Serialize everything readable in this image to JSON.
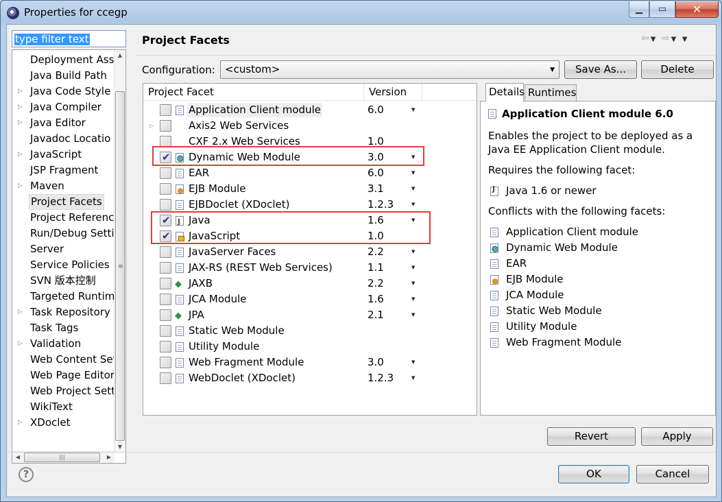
{
  "window": {
    "title": "Properties for ccegp"
  },
  "filter": {
    "value": "type filter text"
  },
  "tree": {
    "items": [
      {
        "label": "Deployment Asse",
        "expandable": false
      },
      {
        "label": "Java Build Path",
        "expandable": false
      },
      {
        "label": "Java Code Style",
        "expandable": true
      },
      {
        "label": "Java Compiler",
        "expandable": true
      },
      {
        "label": "Java Editor",
        "expandable": true
      },
      {
        "label": "Javadoc Locatio",
        "expandable": false
      },
      {
        "label": "JavaScript",
        "expandable": true
      },
      {
        "label": "JSP Fragment",
        "expandable": false
      },
      {
        "label": "Maven",
        "expandable": true
      },
      {
        "label": "Project Facets",
        "expandable": false,
        "selected": true
      },
      {
        "label": "Project Referenc",
        "expandable": false
      },
      {
        "label": "Run/Debug Setti",
        "expandable": false
      },
      {
        "label": "Server",
        "expandable": false
      },
      {
        "label": "Service Policies",
        "expandable": false
      },
      {
        "label": "SVN 版本控制",
        "expandable": false
      },
      {
        "label": "Targeted Runtim",
        "expandable": false
      },
      {
        "label": "Task Repository",
        "expandable": true
      },
      {
        "label": "Task Tags",
        "expandable": false
      },
      {
        "label": "Validation",
        "expandable": true
      },
      {
        "label": "Web Content Set",
        "expandable": false
      },
      {
        "label": "Web Page Editor",
        "expandable": false
      },
      {
        "label": "Web Project Sett",
        "expandable": false
      },
      {
        "label": "WikiText",
        "expandable": false
      },
      {
        "label": "XDoclet",
        "expandable": true
      }
    ]
  },
  "page": {
    "title": "Project Facets"
  },
  "configuration": {
    "label": "Configuration:",
    "value": "<custom>",
    "save_as": "Save As...",
    "delete": "Delete"
  },
  "facets": {
    "col_facet": "Project Facet",
    "col_version": "Version",
    "rows": [
      {
        "name": "Application Client module",
        "version": "6.0",
        "checked": false,
        "has_dropdown": true,
        "icon": "page-icon",
        "highlight": true
      },
      {
        "name": "Axis2 Web Services",
        "version": "",
        "checked": false,
        "has_dropdown": false,
        "icon": "",
        "expandable": true
      },
      {
        "name": "CXF 2.x Web Services",
        "version": "1.0",
        "checked": false,
        "has_dropdown": false,
        "icon": ""
      },
      {
        "name": "Dynamic Web Module",
        "version": "3.0",
        "checked": true,
        "has_dropdown": true,
        "icon": "globe-icon"
      },
      {
        "name": "EAR",
        "version": "6.0",
        "checked": false,
        "has_dropdown": true,
        "icon": "page-icon"
      },
      {
        "name": "EJB Module",
        "version": "3.1",
        "checked": false,
        "has_dropdown": true,
        "icon": "bean-icon"
      },
      {
        "name": "EJBDoclet (XDoclet)",
        "version": "1.2.3",
        "checked": false,
        "has_dropdown": true,
        "icon": "page-icon"
      },
      {
        "name": "Java",
        "version": "1.6",
        "checked": true,
        "has_dropdown": true,
        "icon": "java-cup-icon"
      },
      {
        "name": "JavaScript",
        "version": "1.0",
        "checked": true,
        "has_dropdown": false,
        "icon": "javascript-icon"
      },
      {
        "name": "JavaServer Faces",
        "version": "2.2",
        "checked": false,
        "has_dropdown": true,
        "icon": "page-icon"
      },
      {
        "name": "JAX-RS (REST Web Services)",
        "version": "1.1",
        "checked": false,
        "has_dropdown": true,
        "icon": "page-icon"
      },
      {
        "name": "JAXB",
        "version": "2.2",
        "checked": false,
        "has_dropdown": true,
        "icon": "jaxb-icon"
      },
      {
        "name": "JCA Module",
        "version": "1.6",
        "checked": false,
        "has_dropdown": true,
        "icon": "page-icon"
      },
      {
        "name": "JPA",
        "version": "2.1",
        "checked": false,
        "has_dropdown": true,
        "icon": "jaxb-icon"
      },
      {
        "name": "Static Web Module",
        "version": "",
        "checked": false,
        "has_dropdown": false,
        "icon": "page-icon"
      },
      {
        "name": "Utility Module",
        "version": "",
        "checked": false,
        "has_dropdown": false,
        "icon": "page-icon"
      },
      {
        "name": "Web Fragment Module",
        "version": "3.0",
        "checked": false,
        "has_dropdown": true,
        "icon": "page-icon"
      },
      {
        "name": "WebDoclet (XDoclet)",
        "version": "1.2.3",
        "checked": false,
        "has_dropdown": true,
        "icon": "page-icon"
      }
    ]
  },
  "details": {
    "tab_details": "Details",
    "tab_runtimes": "Runtimes",
    "heading": "Application Client module 6.0",
    "desc_line1": "Enables the project to be deployed as a",
    "desc_line2": "Java EE Application Client module.",
    "requires_label": "Requires the following facet:",
    "requires": [
      {
        "text": "Java 1.6 or newer",
        "icon": "java-cup-icon"
      }
    ],
    "conflicts_label": "Conflicts with the following facets:",
    "conflicts": [
      {
        "text": "Application Client module",
        "icon": "page-icon"
      },
      {
        "text": "Dynamic Web Module",
        "icon": "globe-icon"
      },
      {
        "text": "EAR",
        "icon": "page-icon"
      },
      {
        "text": "EJB Module",
        "icon": "bean-icon"
      },
      {
        "text": "JCA Module",
        "icon": "page-icon"
      },
      {
        "text": "Static Web Module",
        "icon": "page-icon"
      },
      {
        "text": "Utility Module",
        "icon": "page-icon"
      },
      {
        "text": "Web Fragment Module",
        "icon": "page-icon"
      }
    ]
  },
  "buttons": {
    "revert": "Revert",
    "apply": "Apply",
    "ok": "OK",
    "cancel": "Cancel",
    "help": "?"
  },
  "colors": {
    "highlight_box": "#e53b3b",
    "selection": "#3399ff"
  }
}
